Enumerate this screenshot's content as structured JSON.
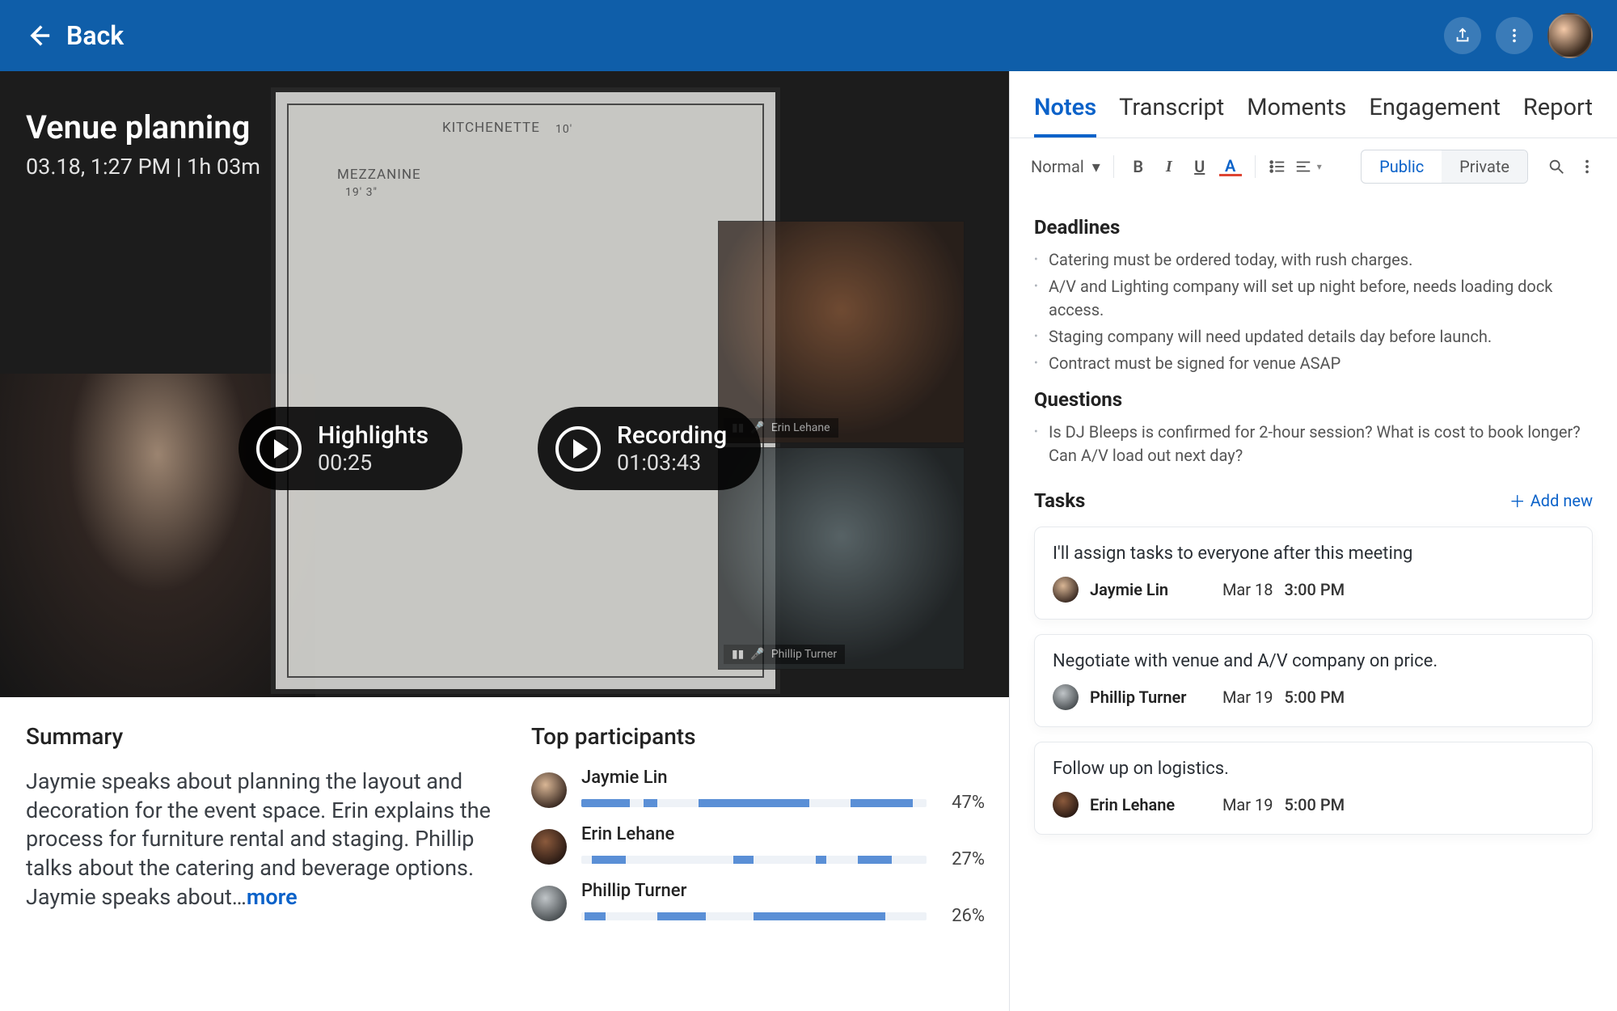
{
  "header": {
    "back_label": "Back"
  },
  "meeting": {
    "title": "Venue planning",
    "meta": "03.18, 1:27 PM | 1h 03m",
    "highlights_label": "Highlights",
    "highlights_time": "00:25",
    "recording_label": "Recording",
    "recording_time": "01:03:43",
    "floorplan": {
      "mezz": "MEZZANINE",
      "kit": "KITCHENETTE",
      "dim1": "19' 3\"",
      "dim2": "10'"
    },
    "tile1_name": "Erin Lehane",
    "tile2_name": "Phillip Turner"
  },
  "summary": {
    "heading": "Summary",
    "text": "Jaymie speaks about planning the layout and decoration for the event space. Erin explains the process for furniture rental and staging. Phillip talks about the catering and beverage options. Jaymie speaks about…",
    "more": "more"
  },
  "participants": {
    "heading": "Top participants",
    "rows": [
      {
        "name": "Jaymie Lin",
        "pct": "47%"
      },
      {
        "name": "Erin Lehane",
        "pct": "27%"
      },
      {
        "name": "Phillip Turner",
        "pct": "26%"
      }
    ]
  },
  "tabs": [
    "Notes",
    "Transcript",
    "Moments",
    "Engagement",
    "Report"
  ],
  "toolbar": {
    "style_select": "Normal",
    "public": "Public",
    "private": "Private"
  },
  "notes": {
    "deadlines_h": "Deadlines",
    "deadlines": [
      "Catering must be ordered today, with rush charges.",
      "A/V and Lighting company will set up night before, needs loading dock access.",
      "Staging company will need updated details day before launch.",
      "Contract must be signed for venue ASAP"
    ],
    "questions_h": "Questions",
    "questions": [
      "Is DJ Bleeps is confirmed for 2-hour session? What is cost to book longer? Can A/V load out next day?"
    ],
    "tasks_h": "Tasks",
    "add_new": "Add new",
    "tasks": [
      {
        "title": "I'll assign tasks to everyone after this meeting",
        "name": "Jaymie Lin",
        "date": "Mar 18",
        "time": "3:00 PM"
      },
      {
        "title": "Negotiate with venue and A/V company on price.",
        "name": "Phillip Turner",
        "date": "Mar 19",
        "time": "5:00 PM"
      },
      {
        "title": "Follow up on logistics.",
        "name": "Erin Lehane",
        "date": "Mar 19",
        "time": "5:00 PM"
      }
    ]
  }
}
